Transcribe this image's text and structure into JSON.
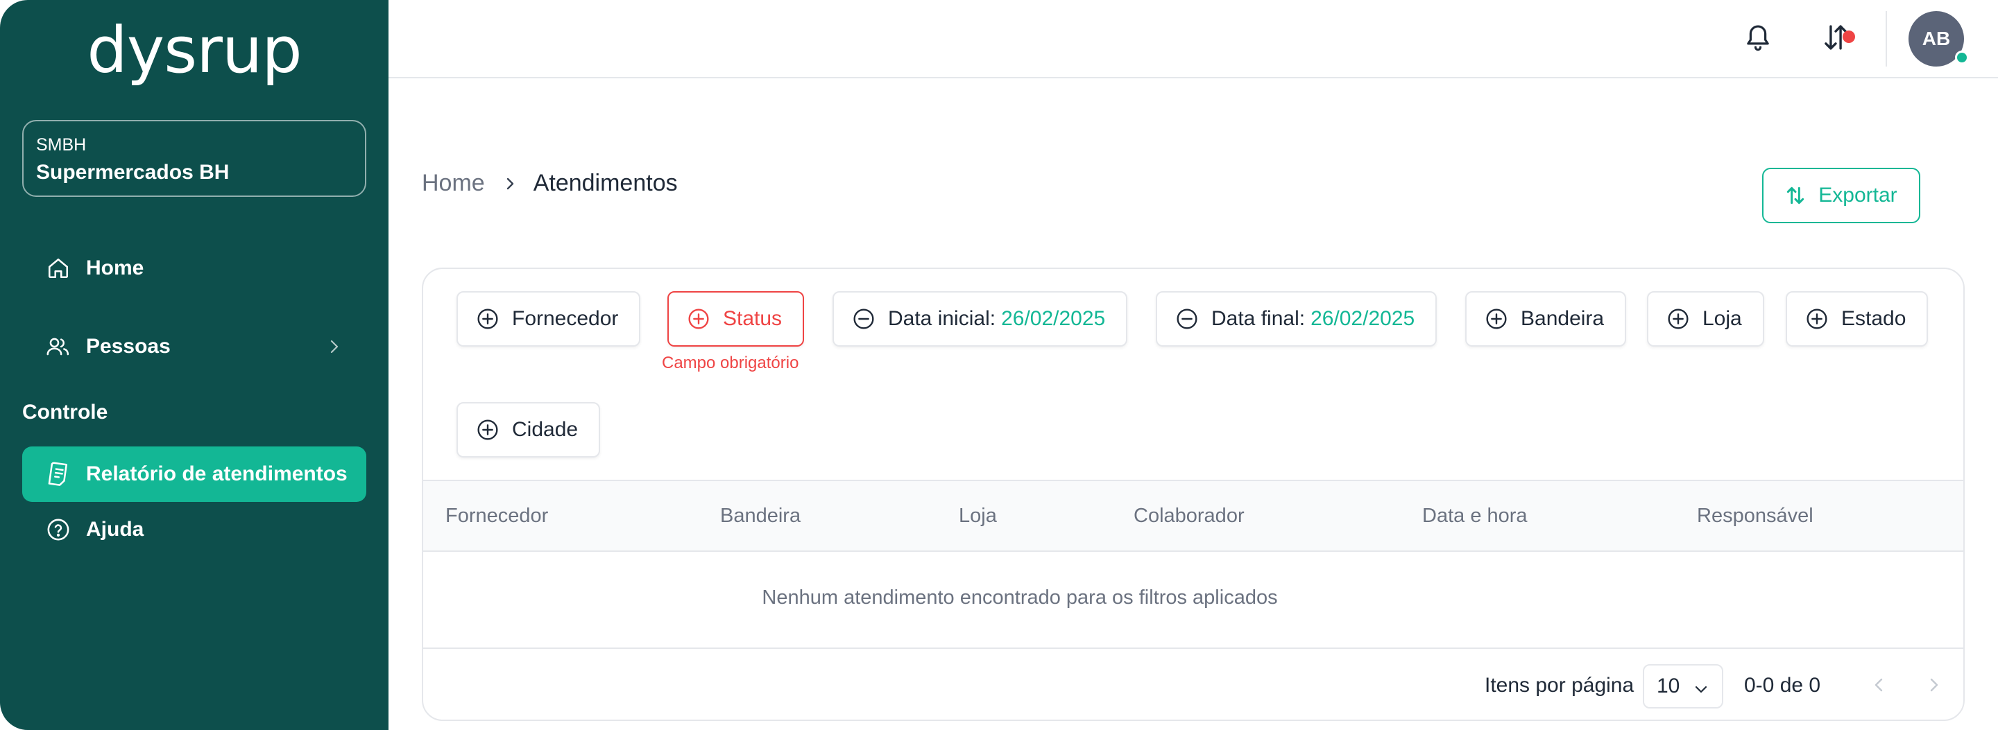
{
  "sidebar": {
    "logo": "dysrup",
    "org_code": "SMBH",
    "org_name": "Supermercados BH",
    "items": [
      {
        "label": "Home",
        "icon": "home-icon"
      },
      {
        "label": "Pessoas",
        "icon": "people-icon"
      }
    ],
    "section": "Controle",
    "control_items": [
      {
        "label": "Relatório de atendimentos",
        "icon": "report-icon"
      },
      {
        "label": "Ajuda",
        "icon": "help-icon"
      }
    ]
  },
  "header": {
    "avatar_initials": "AB"
  },
  "breadcrumb": {
    "home": "Home",
    "current": "Atendimentos"
  },
  "export_label": "Exportar",
  "filters": {
    "fornecedor": "Fornecedor",
    "status": "Status",
    "status_error": "Campo obrigatório",
    "data_inicial_label": "Data inicial:",
    "data_inicial_value": "26/02/2025",
    "data_final_label": "Data final:",
    "data_final_value": "26/02/2025",
    "bandeira": "Bandeira",
    "loja": "Loja",
    "estado": "Estado",
    "cidade": "Cidade"
  },
  "table": {
    "columns": [
      "Fornecedor",
      "Bandeira",
      "Loja",
      "Colaborador",
      "Data e hora",
      "Responsável"
    ],
    "empty_message": "Nenhum atendimento encontrado para os filtros aplicados"
  },
  "pagination": {
    "items_per_page_label": "Itens por página",
    "items_per_page": "10",
    "range": "0-0 de 0"
  },
  "colors": {
    "sidebar_bg": "#0d4f4c",
    "accent": "#13b795",
    "error": "#ef4444"
  }
}
